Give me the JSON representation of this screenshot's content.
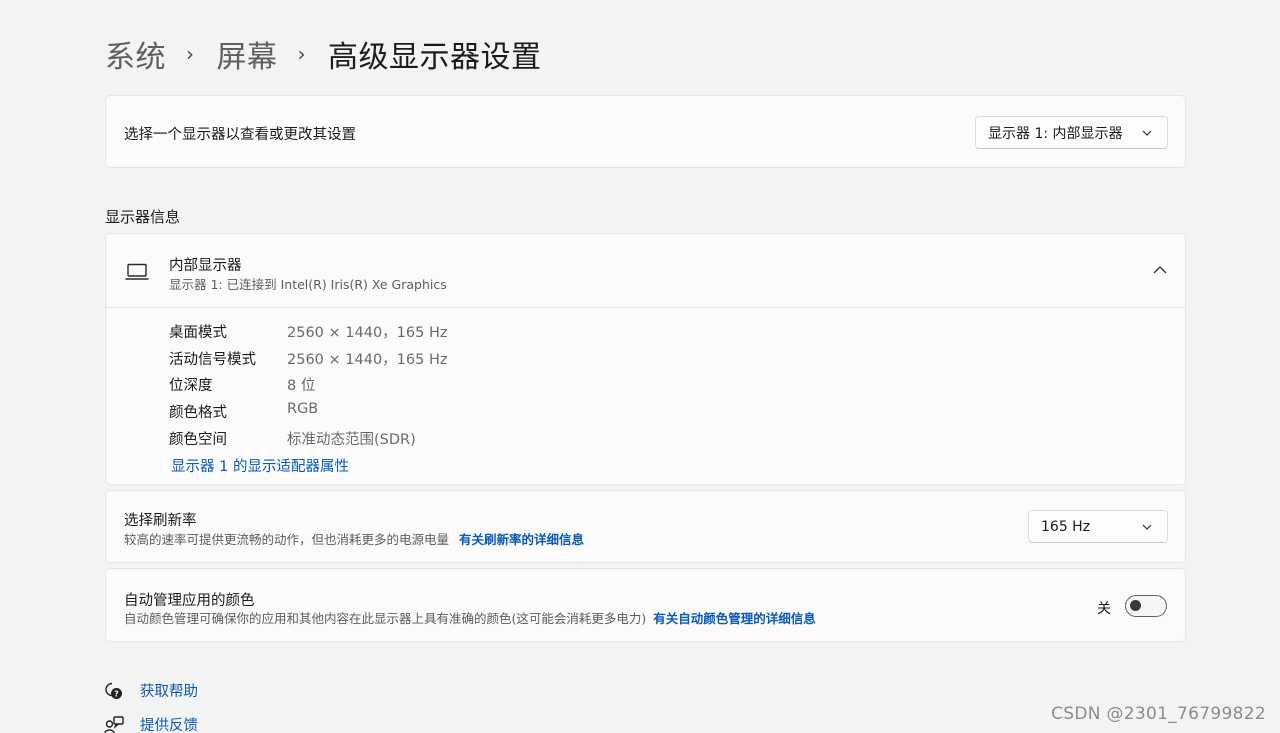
{
  "breadcrumb": {
    "item1": "系统",
    "item2": "屏幕",
    "current": "高级显示器设置"
  },
  "display_select": {
    "label": "选择一个显示器以查看或更改其设置",
    "value": "显示器 1: 内部显示器"
  },
  "display_info": {
    "section_label": "显示器信息",
    "title": "内部显示器",
    "subtitle": "显示器 1: 已连接到 Intel(R) Iris(R) Xe Graphics",
    "specs": [
      {
        "label": "桌面模式",
        "value": "2560 × 1440，165 Hz"
      },
      {
        "label": "活动信号模式",
        "value": "2560 × 1440，165 Hz"
      },
      {
        "label": "位深度",
        "value": "8 位"
      },
      {
        "label": "颜色格式",
        "value": "RGB"
      },
      {
        "label": "颜色空间",
        "value": "标准动态范围(SDR)"
      }
    ],
    "adapter_link": "显示器 1 的显示适配器属性"
  },
  "refresh_rate": {
    "title": "选择刷新率",
    "description": "较高的速率可提供更流畅的动作，但也消耗更多的电源电量",
    "link": "有关刷新率的详细信息",
    "value": "165 Hz"
  },
  "auto_color": {
    "title": "自动管理应用的颜色",
    "description": "自动颜色管理可确保你的应用和其他内容在此显示器上具有准确的颜色(这可能会消耗更多电力)",
    "link": "有关自动颜色管理的详细信息",
    "toggle_label": "关",
    "toggle_on": false
  },
  "footer": {
    "help": "获取帮助",
    "feedback": "提供反馈"
  },
  "watermark": "CSDN @2301_76799822",
  "colors": {
    "accent": "#0a5ab8",
    "background": "#f3f3f3",
    "card": "#fbfbfb"
  }
}
